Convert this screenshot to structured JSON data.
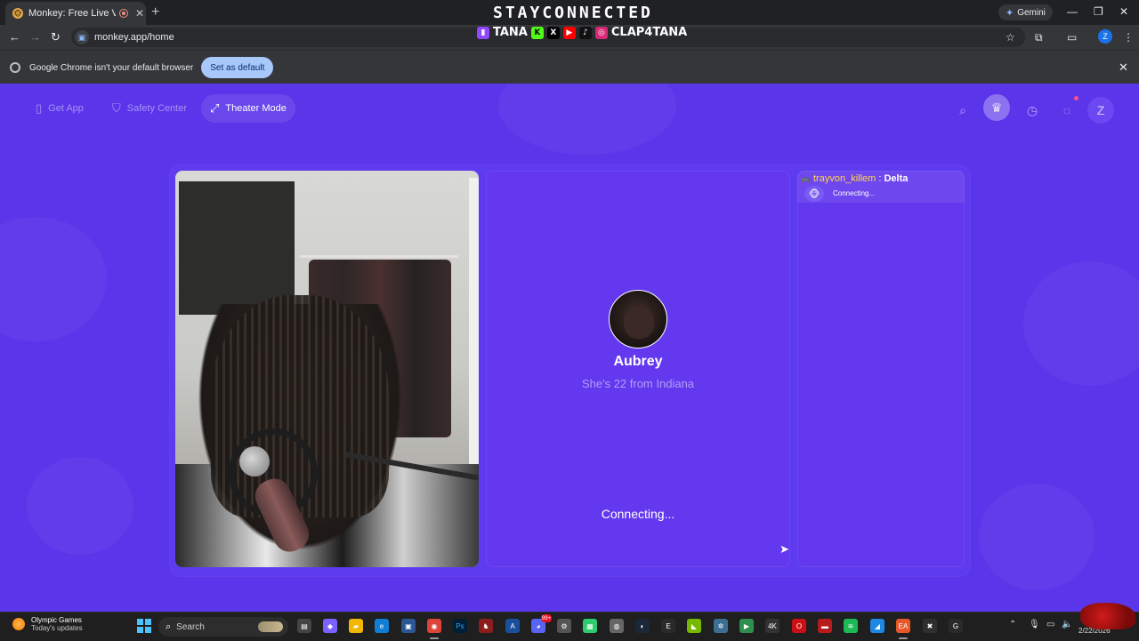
{
  "browser": {
    "tab_title": "Monkey: Free Live Video Ch",
    "tab_favicon": "monkey-favicon",
    "new_tab_icon": "+",
    "gemini_label": "Gemini",
    "url": "monkey.app/home",
    "infobar_message": "Google Chrome isn't your default browser",
    "set_default_label": "Set as default"
  },
  "stream_overlay": {
    "banner": "STAYCONNECTED",
    "handle_left": "TANA",
    "handle_right": "CLAP4TANA"
  },
  "app": {
    "nav": {
      "get_app": "Get App",
      "safety_center": "Safety Center",
      "theater_mode": "Theater Mode"
    },
    "profile_initial": "Z",
    "match": {
      "name": "Aubrey",
      "subtitle": "She's 22 from Indiana",
      "status": "Connecting..."
    },
    "chat": {
      "username": "trayvon_killem",
      "separator": " : ",
      "game": "Delta",
      "status": "Connecting..."
    }
  },
  "taskbar": {
    "weather_title": "Olympic Games",
    "weather_sub": "Today's updates",
    "search_placeholder": "Search",
    "badge": "99+",
    "date": "2/22/2026"
  },
  "colors": {
    "page_bg": "#5b35ea",
    "accent_yellow": "#ffd54a",
    "set_default_bg": "#a8c7fa"
  }
}
